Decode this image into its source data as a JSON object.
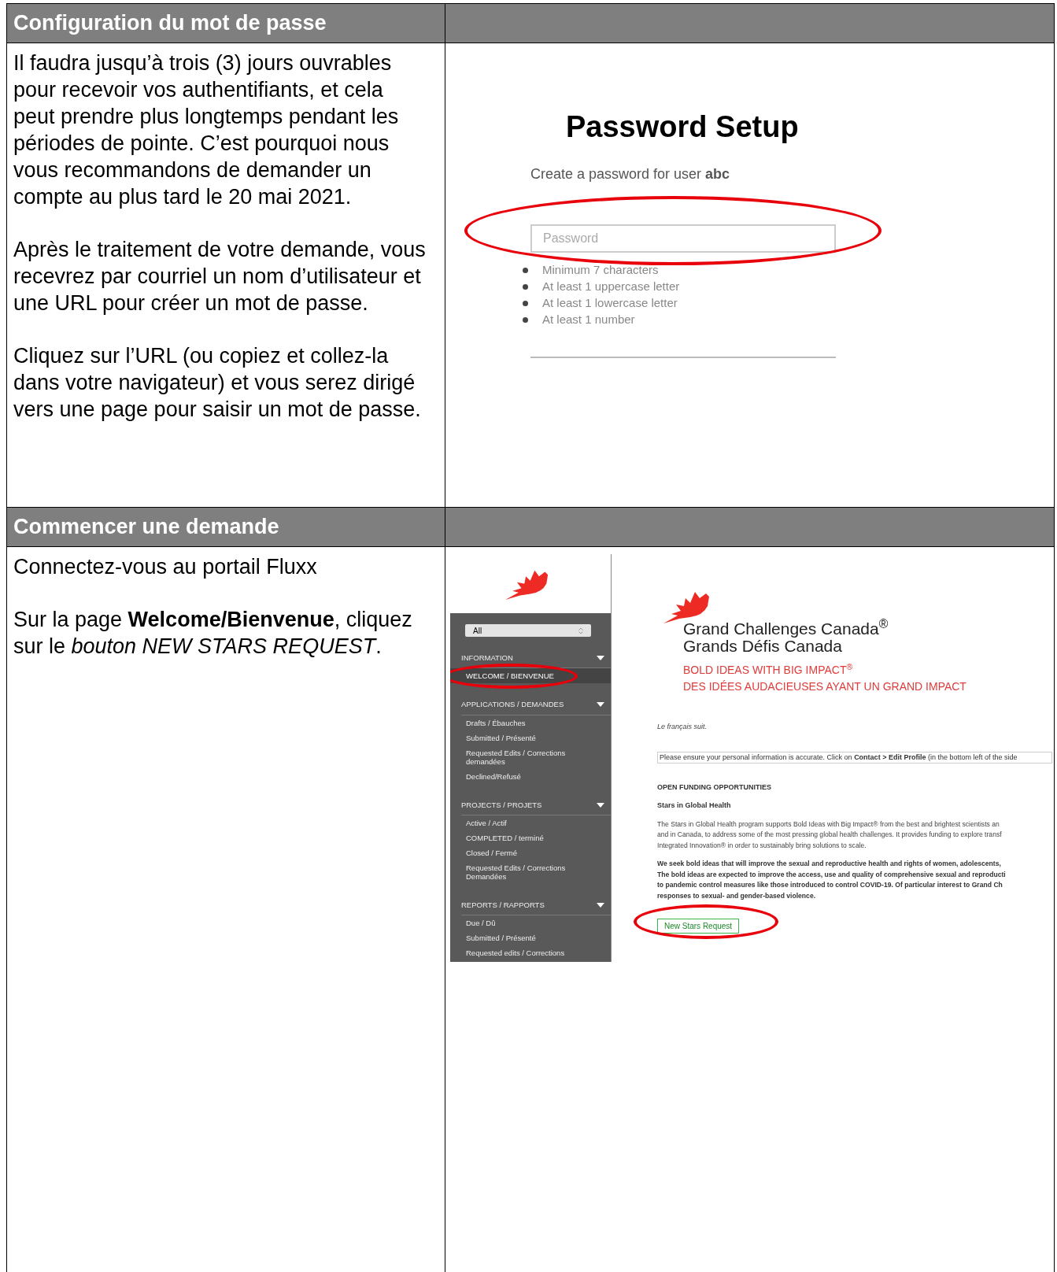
{
  "sections": [
    {
      "heading": "Configuration du mot de passe",
      "paragraphs": [
        "Il faudra jusqu’à trois (3) jours ouvrables pour recevoir vos authentifiants, et cela peut prendre plus longtemps pendant les périodes de pointe. C’est pourquoi nous vous recommandons de demander un compte au plus tard le 20 mai 2021.",
        "Après le traitement de votre demande, vous recevrez par courriel un nom d’utilisateur et une URL pour créer un mot de passe.",
        "Cliquez sur l’URL (ou copiez et collez-la dans votre navigateur) et vous serez dirigé vers une page pour saisir un mot de passe."
      ],
      "screenshot": {
        "kind": "password",
        "title": "Password Setup",
        "subtitle": "Create a password for user **abc**",
        "placeholder": "Password",
        "highlighted": true,
        "rules": [
          "Minimum 7 characters",
          "At least 1 uppercase letter",
          "At least 1 lowercase letter",
          "At least 1 number"
        ]
      }
    },
    {
      "heading": "Commencer une demande",
      "paragraphs": [
        "Connectez-vous au portail Fluxx",
        "Sur la page **Welcome/Bienvenue**, cliquez sur le *bouton NEW STARS REQUEST*."
      ],
      "screenshot": {
        "kind": "portal",
        "sidebar": {
          "filter": "All",
          "groups": [
            {
              "title": "INFORMATION",
              "items": [
                {
                  "label": "WELCOME / BIENVENUE",
                  "selected": true,
                  "highlighted": true
                }
              ]
            },
            {
              "title": "APPLICATIONS / DEMANDES",
              "items": [
                {
                  "label": "Drafts / Ébauches",
                  "selected": false,
                  "highlighted": false
                },
                {
                  "label": "Submitted / Présenté",
                  "selected": false,
                  "highlighted": false
                },
                {
                  "label": "Requested Edits / Corrections demandées",
                  "selected": false,
                  "highlighted": false
                },
                {
                  "label": "Declined/Refusé",
                  "selected": false,
                  "highlighted": false
                }
              ]
            },
            {
              "title": "PROJECTS / PROJETS",
              "items": [
                {
                  "label": "Active / Actif",
                  "selected": false,
                  "highlighted": false
                },
                {
                  "label": "COMPLETED / terminé",
                  "selected": false,
                  "highlighted": false
                },
                {
                  "label": "Closed / Fermé",
                  "selected": false,
                  "highlighted": false
                },
                {
                  "label": "Requested Edits / Corrections Demandées",
                  "selected": false,
                  "highlighted": false
                }
              ]
            },
            {
              "title": "REPORTS / RAPPORTS",
              "items": [
                {
                  "label": "Due / Dû",
                  "selected": false,
                  "highlighted": false
                },
                {
                  "label": "Submitted / Présenté",
                  "selected": false,
                  "highlighted": false
                },
                {
                  "label": "Requested edits / Corrections",
                  "selected": false,
                  "highlighted": false
                }
              ]
            }
          ]
        },
        "logo_lines": [
          "Grand Challenges Canada$^{®}$",
          "Grands Défis Canada"
        ],
        "tagline_lines": [
          "BOLD IDEAS WITH BIG IMPACT$^{®}$",
          "DES IDÉES AUDACIEUSES AYANT UN GRAND IMPACT"
        ],
        "note": "Le français suit.",
        "notice": "Please ensure your personal information is accurate. Click on **Contact > Edit Profile** (in the bottom left of the side",
        "section_title": "OPEN FUNDING OPPORTUNITIES",
        "program_title": "Stars in Global Health",
        "description_lines": [
          "The Stars in Global Health program supports Bold Ideas with Big Impact® from the best and brightest scientists an",
          "and in Canada, to address some of the most pressing global health challenges. It provides funding to explore transf",
          "Integrated Innovation® in order to sustainably bring solutions to scale."
        ],
        "emphasis_lines": [
          "We seek bold ideas that will improve the sexual and reproductive health and rights of women, adolescents,",
          "The bold ideas are expected to improve the access, use and quality of comprehensive sexual and reproducti",
          "to pandemic control measures like those introduced to control COVID-19. Of particular interest to Grand Ch",
          "responses to sexual- and gender-based violence."
        ],
        "button": {
          "label": "New Stars Request",
          "highlighted": true
        }
      }
    }
  ]
}
